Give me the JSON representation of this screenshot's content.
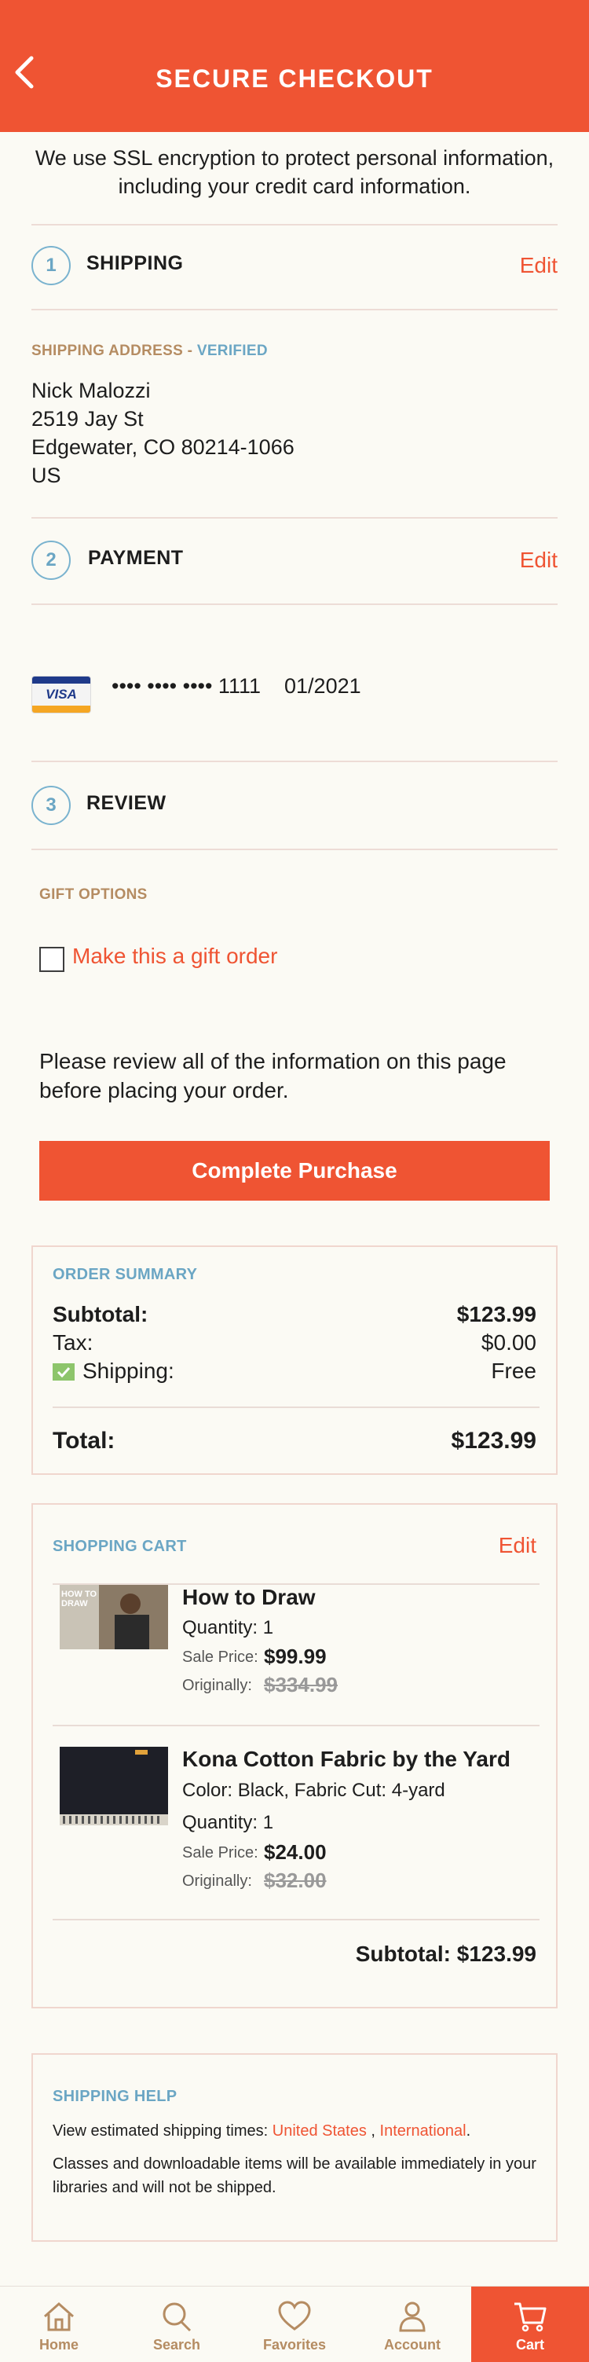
{
  "header": {
    "title": "SECURE CHECKOUT"
  },
  "ssl_note": "We use SSL encryption to protect personal information, including your credit card information.",
  "shipping": {
    "step": "1",
    "title": "SHIPPING",
    "edit_label": "Edit",
    "address_heading": "SHIPPING ADDRESS - ",
    "verified_label": "VERIFIED",
    "address_lines": [
      "Nick Malozzi",
      "2519 Jay St",
      "Edgewater, CO 80214-1066",
      "US"
    ]
  },
  "payment": {
    "step": "2",
    "title": "PAYMENT",
    "edit_label": "Edit",
    "card_brand": "VISA",
    "card_number": "•••• •••• •••• 1111",
    "card_expiry": "01/2021"
  },
  "review": {
    "step": "3",
    "title": "REVIEW",
    "gift_heading": "GIFT OPTIONS",
    "gift_label": "Make this a gift order",
    "gift_checked": false,
    "review_instructions": "Please review all of the information on this page before placing your order.",
    "complete_button": "Complete Purchase"
  },
  "order_summary": {
    "heading": "ORDER SUMMARY",
    "subtotal_label": "Subtotal:",
    "subtotal_value": "$123.99",
    "tax_label": "Tax:",
    "tax_value": "$0.00",
    "shipping_label": "Shipping:",
    "shipping_value": "Free",
    "total_label": "Total:",
    "total_value": "$123.99"
  },
  "cart": {
    "heading": "SHOPPING CART",
    "edit_label": "Edit",
    "items": [
      {
        "title": "How to Draw",
        "quantity": "Quantity: 1",
        "sale_label": "Sale Price:",
        "sale_price": "$99.99",
        "orig_label": "Originally:",
        "orig_price": "$334.99",
        "thumb_text": "HOW TO DRAW"
      },
      {
        "title": "Kona Cotton Fabric by the Yard",
        "detail": "Color: Black, Fabric Cut: 4-yard",
        "quantity": "Quantity: 1",
        "sale_label": "Sale Price:",
        "sale_price": "$24.00",
        "orig_label": "Originally:",
        "orig_price": "$32.00"
      }
    ],
    "subtotal": "Subtotal: $123.99"
  },
  "shipping_help": {
    "heading": "SHIPPING HELP",
    "line1_prefix": "View estimated shipping times: ",
    "link_us": "United States",
    "separator": " , ",
    "link_intl": "International",
    "line1_suffix": ".",
    "line2": "Classes and downloadable items will be available immediately in your libraries and will not be shipped."
  },
  "bottom_nav": {
    "items": [
      {
        "label": "Home",
        "icon": "home-icon"
      },
      {
        "label": "Search",
        "icon": "search-icon"
      },
      {
        "label": "Favorites",
        "icon": "heart-icon"
      },
      {
        "label": "Account",
        "icon": "user-icon"
      },
      {
        "label": "Cart",
        "icon": "cart-icon",
        "active": true
      }
    ]
  },
  "colors": {
    "accent": "#ef5433",
    "info_blue": "#6ba6c4",
    "tan": "#b58c62",
    "background": "#fbfaf4"
  }
}
